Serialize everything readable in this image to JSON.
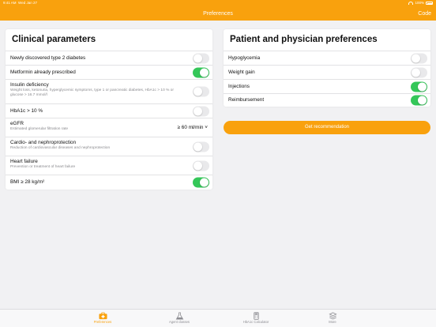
{
  "status": {
    "time": "9:41 AM",
    "date": "Wed Jan 27",
    "battery": "100%"
  },
  "nav": {
    "title": "Preferences",
    "right": "Code"
  },
  "clinical": {
    "title": "Clinical parameters",
    "rows": [
      {
        "label": "Newly discovered type 2 diabetes",
        "on": false
      },
      {
        "label": "Metformin already prescribed",
        "on": true
      },
      {
        "label": "Insulin deficiency",
        "sub": "Weight loss, ketonuria, hyperglycemic symptoms, type 1 or pancreatic diabetes, HbA1c > 10 % or glucose > 16.7 mmol/l",
        "on": false
      },
      {
        "label": "HbA1c > 10 %",
        "on": false
      },
      {
        "label": "eGFR",
        "sub": "Estimated glomerular filtration rate",
        "value": "≥ 60 ml/min ˅"
      },
      {
        "label": "Cardio- and nephroprotection",
        "sub": "Reduction of cardiovascular diseases and nephroprotection",
        "on": false
      },
      {
        "label": "Heart failure",
        "sub": "Prevention or treatment of heart failure",
        "on": false
      },
      {
        "label": "BMI ≥ 28 kg/m²",
        "on": true
      }
    ]
  },
  "preferences": {
    "title": "Patient and physician preferences",
    "rows": [
      {
        "label": "Hypoglycemia",
        "on": false
      },
      {
        "label": "Weight gain",
        "on": false
      },
      {
        "label": "Injections",
        "on": true
      },
      {
        "label": "Reimbursement",
        "on": true
      }
    ]
  },
  "button": {
    "label": "Get recommendation"
  },
  "tabs": [
    {
      "label": "Preferences",
      "icon": "medkit-icon"
    },
    {
      "label": "Agent classes",
      "icon": "flask-icon"
    },
    {
      "label": "HbA1c Calculator",
      "icon": "calculator-icon"
    },
    {
      "label": "More",
      "icon": "stack-icon"
    }
  ],
  "colors": {
    "accent": "#f9a10d",
    "toggle_on": "#34c759",
    "toggle_off": "#e9e9eb"
  }
}
